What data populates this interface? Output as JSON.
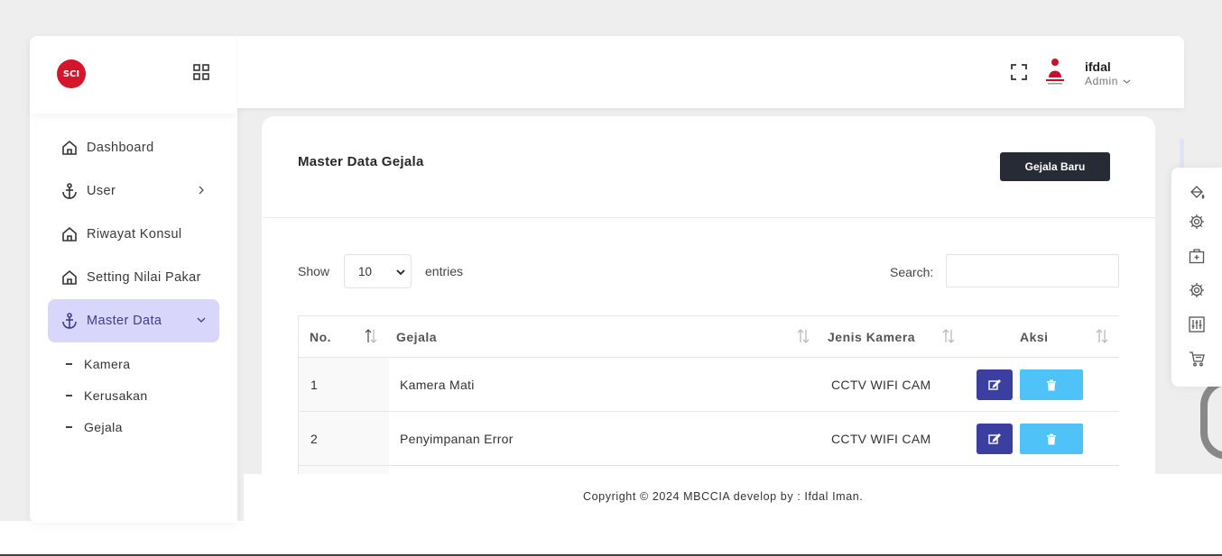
{
  "brand": {
    "logo_text": "SCI"
  },
  "sidebar": {
    "items": [
      {
        "label": "Dashboard",
        "icon": "home-icon"
      },
      {
        "label": "User",
        "icon": "anchor-icon",
        "has_children": true
      },
      {
        "label": "Riwayat Konsul",
        "icon": "home-icon"
      },
      {
        "label": "Setting Nilai Pakar",
        "icon": "home-icon"
      },
      {
        "label": "Master Data",
        "icon": "anchor-icon",
        "active": true,
        "expanded": true
      }
    ],
    "submenu": [
      {
        "label": "Kamera"
      },
      {
        "label": "Kerusakan"
      },
      {
        "label": "Gejala"
      }
    ]
  },
  "header": {
    "user_name": "ifdal",
    "user_role": "Admin"
  },
  "page": {
    "title": "Master Data Gejala",
    "new_button": "Gejala Baru",
    "show_label": "Show",
    "page_length": "10",
    "entries_label": "entries",
    "search_label": "Search:",
    "search_value": ""
  },
  "table": {
    "columns": [
      "No.",
      "Gejala",
      "Jenis Kamera",
      "Aksi"
    ],
    "rows": [
      {
        "no": "1",
        "gejala": "Kamera Mati",
        "jenis_kamera": "CCTV WIFI CAM"
      },
      {
        "no": "2",
        "gejala": "Penyimpanan Error",
        "jenis_kamera": "CCTV WIFI CAM"
      }
    ]
  },
  "footer": {
    "copyright": "Copyright © 2024 MBCCIA develop by : Ifdal Iman."
  },
  "colors": {
    "accent": "#3a3fa0",
    "active_menu_bg": "#d9d6fb",
    "delete_button": "#4fc3f7",
    "dark_button": "#262b36",
    "logo_red": "#d4152b"
  },
  "right_panel": {
    "icons": [
      "paint-bucket-icon",
      "gear-icon",
      "briefcase-plus-icon",
      "gear-icon",
      "sliders-icon",
      "cart-icon"
    ]
  }
}
